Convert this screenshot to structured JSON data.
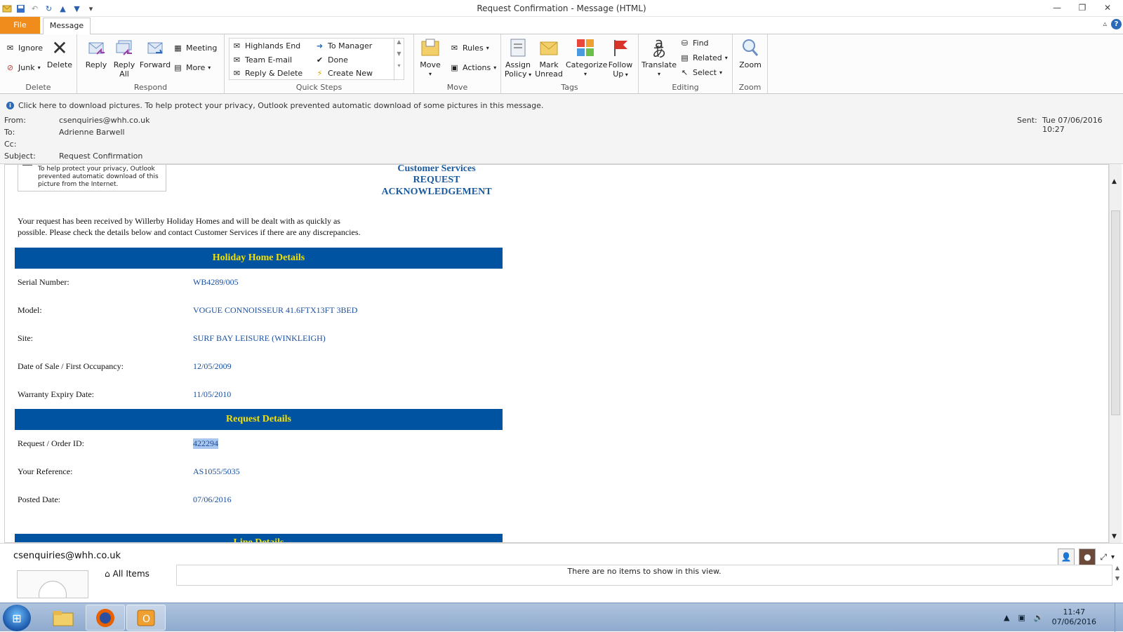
{
  "window": {
    "title": "Request Confirmation  -  Message (HTML)"
  },
  "tabs": {
    "file": "File",
    "message": "Message"
  },
  "ribbon": {
    "delete": {
      "label": "Delete",
      "ignore": "Ignore",
      "junk": "Junk",
      "delete": "Delete"
    },
    "respond": {
      "label": "Respond",
      "reply": "Reply",
      "reply_all_1": "Reply",
      "reply_all_2": "All",
      "forward": "Forward",
      "meeting": "Meeting",
      "more": "More"
    },
    "quick_steps": {
      "label": "Quick Steps",
      "items": [
        "Highlands End",
        "Team E-mail",
        "Reply & Delete",
        "To Manager",
        "Done",
        "Create New"
      ]
    },
    "move": {
      "label": "Move",
      "move": "Move",
      "rules": "Rules",
      "actions": "Actions"
    },
    "tags": {
      "label": "Tags",
      "assign_1": "Assign",
      "assign_2": "Policy",
      "mark_1": "Mark",
      "mark_2": "Unread",
      "categorize": "Categorize",
      "follow_1": "Follow",
      "follow_2": "Up"
    },
    "editing": {
      "label": "Editing",
      "translate": "Translate",
      "find": "Find",
      "related": "Related",
      "select": "Select"
    },
    "zoom": {
      "label": "Zoom",
      "zoom": "Zoom"
    }
  },
  "header": {
    "info_bar": "Click here to download pictures. To help protect your privacy, Outlook prevented automatic download of some pictures in this message.",
    "from_label": "From:",
    "from": "csenquiries@whh.co.uk",
    "to_label": "To:",
    "to": "Adrienne Barwell",
    "cc_label": "Cc:",
    "subject_label": "Subject:",
    "subject": "Request Confirmation",
    "sent_label": "Sent:",
    "sent": "Tue 07/06/2016 10:27"
  },
  "email": {
    "blocked_image_text": "To help protect your privacy, Outlook prevented automatic download of this picture from the Internet.",
    "title_1": "Customer Services",
    "title_2": "REQUEST",
    "title_3": "ACKNOWLEDGEMENT",
    "intro_1": "Your request has been received by Willerby Holiday Homes and will be dealt with as quickly as",
    "intro_2": "possible. Please check the details below and contact Customer Services if there are any discrepancies.",
    "section_1": "Holiday Home Details",
    "details": [
      {
        "label": "Serial Number:",
        "value": "WB4289/005"
      },
      {
        "label": "Model:",
        "value": "VOGUE CONNOISSEUR 41.6FTX13FT 3BED"
      },
      {
        "label": "Site:",
        "value": "SURF BAY LEISURE (WINKLEIGH)"
      },
      {
        "label": "Date of Sale / First Occupancy:",
        "value": "12/05/2009"
      },
      {
        "label": "Warranty Expiry Date:",
        "value": "11/05/2010"
      }
    ],
    "section_2": "Request Details",
    "request": [
      {
        "label": "Request / Order ID:",
        "value": "422294"
      },
      {
        "label": "Your Reference:",
        "value": "AS1055/5035"
      },
      {
        "label": "Posted Date:",
        "value": "07/06/2016"
      }
    ],
    "section_3": "Line Details"
  },
  "people_pane": {
    "email": "csenquiries@whh.co.uk",
    "all_items": "All Items",
    "empty": "There are no items to show in this view."
  },
  "taskbar": {
    "time": "11:47",
    "date": "07/06/2016"
  },
  "colors": {
    "accent_file": "#ef8c1c",
    "section_bg": "#0053a0",
    "section_text": "#f5e000",
    "link_blue": "#1a4fa0"
  }
}
